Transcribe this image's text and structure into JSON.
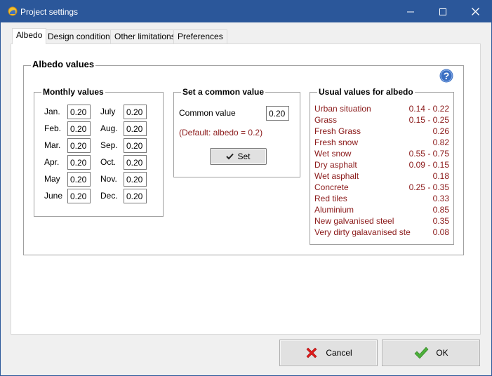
{
  "window": {
    "title": "Project settings"
  },
  "tabs": [
    {
      "label": "Albedo",
      "active": true
    },
    {
      "label": "Design conditions",
      "active": false
    },
    {
      "label": "Other limitations",
      "active": false
    },
    {
      "label": "Preferences",
      "active": false
    }
  ],
  "albedo": {
    "title": "Albedo values",
    "monthly": {
      "title": "Monthly values",
      "months": [
        {
          "label": "Jan.",
          "value": "0.20"
        },
        {
          "label": "Feb.",
          "value": "0.20"
        },
        {
          "label": "Mar.",
          "value": "0.20"
        },
        {
          "label": "Apr.",
          "value": "0.20"
        },
        {
          "label": "May",
          "value": "0.20"
        },
        {
          "label": "June",
          "value": "0.20"
        },
        {
          "label": "July",
          "value": "0.20"
        },
        {
          "label": "Aug.",
          "value": "0.20"
        },
        {
          "label": "Sep.",
          "value": "0.20"
        },
        {
          "label": "Oct.",
          "value": "0.20"
        },
        {
          "label": "Nov.",
          "value": "0.20"
        },
        {
          "label": "Dec.",
          "value": "0.20"
        }
      ]
    },
    "common": {
      "title": "Set a common value",
      "label": "Common value",
      "value": "0.20",
      "default_note": "(Default: albedo = 0.2)",
      "set_label": "Set"
    },
    "usual": {
      "title": "Usual values for albedo",
      "items": [
        {
          "name": "Urban situation",
          "value": "0.14 - 0.22"
        },
        {
          "name": "Grass",
          "value": "0.15 - 0.25"
        },
        {
          "name": "Fresh Grass",
          "value": "0.26"
        },
        {
          "name": "Fresh snow",
          "value": "0.82"
        },
        {
          "name": "Wet snow",
          "value": "0.55 - 0.75"
        },
        {
          "name": "Dry asphalt",
          "value": "0.09 - 0.15"
        },
        {
          "name": "Wet asphalt",
          "value": "0.18"
        },
        {
          "name": "Concrete",
          "value": "0.25 - 0.35"
        },
        {
          "name": "Red tiles",
          "value": "0.33"
        },
        {
          "name": "Aluminium",
          "value": "0.85"
        },
        {
          "name": "New galvanised steel",
          "value": "0.35"
        },
        {
          "name": "Very dirty galavanised ste",
          "value": "0.08"
        }
      ]
    }
  },
  "buttons": {
    "cancel_label": "Cancel",
    "ok_label": "OK"
  },
  "colors": {
    "titlebar": "#2b579a",
    "usual_text": "#8b1a1a",
    "cancel_icon": "#e01b1b",
    "ok_icon": "#4caf3a",
    "help_icon": "#3b6fc2"
  },
  "icons": {
    "app": "sun-icon",
    "minimize": "minimize-icon",
    "maximize": "maximize-icon",
    "close": "close-icon",
    "help": "help-icon",
    "set": "checkmark-icon",
    "cancel": "red-x-icon",
    "ok": "green-checkmark-icon"
  }
}
